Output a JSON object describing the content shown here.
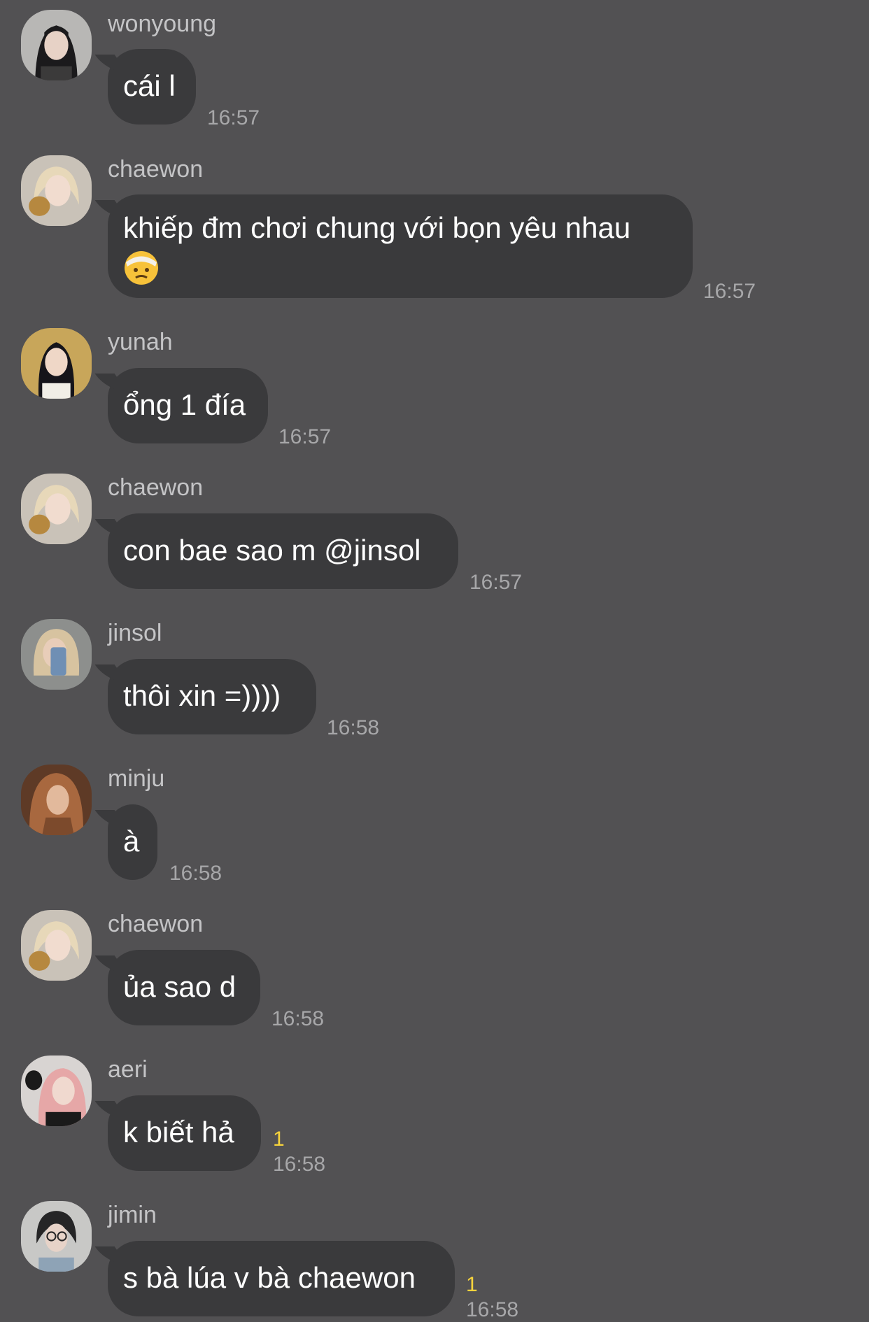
{
  "messages": [
    {
      "sender": "wonyoung",
      "text": "cái l",
      "time": "16:57",
      "unread": "",
      "avatar": "avatar-wonyoung",
      "avatar_colors": {
        "bg": "#b8b7b5",
        "hair": "#1b1a1c",
        "skin": "#e7d2c6",
        "cloth": "#3b3a3a"
      }
    },
    {
      "sender": "chaewon",
      "text": "khiếp đm chơi chung với bọn yêu nhau",
      "emoji": "face-with-head-bandage",
      "time": "16:57",
      "unread": "",
      "avatar": "avatar-chaewon",
      "avatar_colors": {
        "bg": "#c9c2b8",
        "hair": "#e7d8b9",
        "skin": "#f1dccf",
        "cloth": "#b6883f"
      }
    },
    {
      "sender": "yunah",
      "text": "ổng 1 đía",
      "time": "16:57",
      "unread": "",
      "avatar": "avatar-yunah",
      "avatar_colors": {
        "bg": "#c8a65a",
        "hair": "#15141a",
        "skin": "#efd7c7",
        "cloth": "#f1eee6"
      }
    },
    {
      "sender": "chaewon",
      "text": "con bae sao m @jinsol",
      "time": "16:57",
      "unread": "",
      "avatar": "avatar-chaewon",
      "avatar_colors": {
        "bg": "#c9c2b8",
        "hair": "#e7d8b9",
        "skin": "#f1dccf",
        "cloth": "#b6883f"
      }
    },
    {
      "sender": "jinsol",
      "text": "thôi xin =))))",
      "time": "16:58",
      "unread": "",
      "avatar": "avatar-jinsol",
      "avatar_colors": {
        "bg": "#8d8f8d",
        "hair": "#d7c3a0",
        "skin": "#e8cdb9",
        "cloth": "#6f8fb4"
      }
    },
    {
      "sender": "minju",
      "text": "à",
      "time": "16:58",
      "unread": "",
      "avatar": "avatar-minju",
      "avatar_colors": {
        "bg": "#5e3a26",
        "hair": "#a8683f",
        "skin": "#e2b99c",
        "cloth": "#7c4a2c"
      }
    },
    {
      "sender": "chaewon",
      "text": "ủa sao d",
      "time": "16:58",
      "unread": "",
      "avatar": "avatar-chaewon",
      "avatar_colors": {
        "bg": "#c9c2b8",
        "hair": "#e7d8b9",
        "skin": "#f1dccf",
        "cloth": "#b6883f"
      }
    },
    {
      "sender": "aeri",
      "text": "k biết hả",
      "time": "16:58",
      "unread": "1",
      "avatar": "avatar-aeri",
      "avatar_colors": {
        "bg": "#d8d4d2",
        "hair": "#e6a7a7",
        "skin": "#f0d9cf",
        "cloth": "#1a1a1a"
      }
    },
    {
      "sender": "jimin",
      "text": "s bà lúa v bà chaewon",
      "time": "16:58",
      "unread": "1",
      "avatar": "avatar-jimin",
      "avatar_colors": {
        "bg": "#c8c8c6",
        "hair": "#252526",
        "skin": "#e7d3c8",
        "cloth": "#8ea3b6"
      }
    }
  ],
  "colors": {
    "background": "#525153",
    "bubble": "#3a3a3c",
    "text": "#ffffff",
    "sender": "#c4c4c6",
    "time": "#a7a7a9",
    "unread": "#f6d33c"
  }
}
